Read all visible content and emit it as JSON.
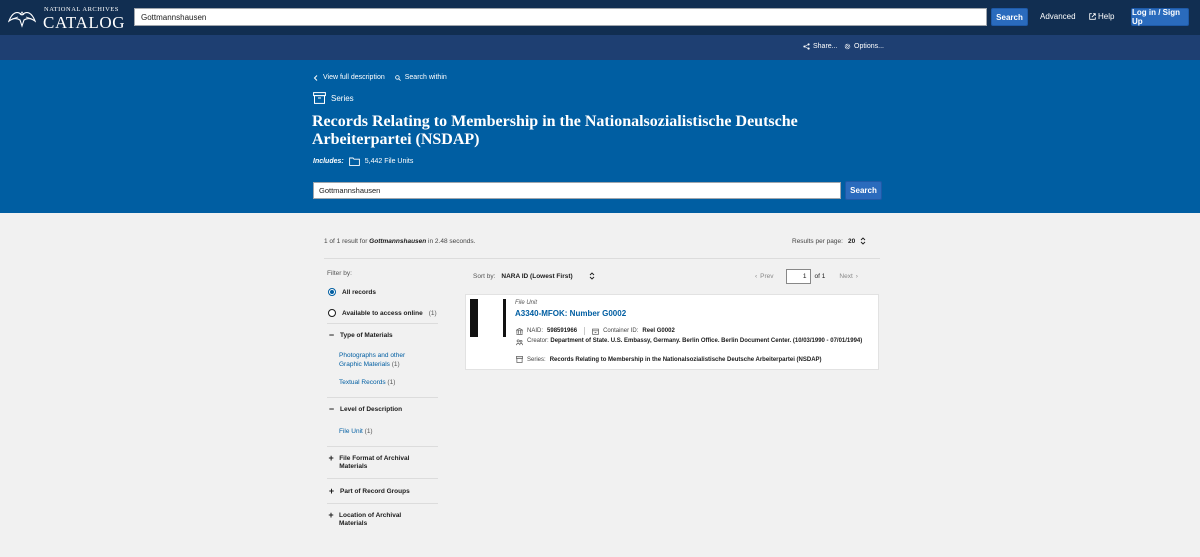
{
  "header": {
    "logo_top": "NATIONAL ARCHIVES",
    "logo_main": "CATALOG",
    "search_value": "Gottmannshausen",
    "search_label": "Search",
    "advanced_label": "Advanced",
    "help_label": "Help",
    "login_label": "Log in / Sign Up"
  },
  "subbar": {
    "share_label": "Share...",
    "options_label": "Options..."
  },
  "hero": {
    "back_label": "View full description",
    "search_within_label": "Search within",
    "level_label": "Series",
    "title": "Records Relating to Membership in the Nationalsozialistische Deutsche Arbeiterpartei (NSDAP)",
    "includes_label": "Includes:",
    "includes_value": "5,442 File Units",
    "search_value": "Gottmannshausen",
    "search_label": "Search"
  },
  "results": {
    "count_prefix": "1 of 1 result for",
    "query": "Gottmannshausen",
    "count_suffix": "in 2.48 seconds.",
    "per_page_label": "Results per page:",
    "per_page_value": "20"
  },
  "filters": {
    "title": "Filter by:",
    "all_records": "All records",
    "online_label": "Available to access online",
    "online_count": "(1)",
    "type_heading": "Type of Materials",
    "type_items": [
      {
        "label": "Photographs and other Graphic Materials",
        "count": "(1)"
      },
      {
        "label": "Textual Records",
        "count": "(1)"
      }
    ],
    "level_heading": "Level of Description",
    "level_items": [
      {
        "label": "File Unit",
        "count": "(1)"
      }
    ],
    "format_heading": "File Format of Archival Materials",
    "group_heading": "Part of Record Groups",
    "location_heading": "Location of Archival Materials"
  },
  "sort": {
    "label": "Sort by:",
    "value": "NARA ID (Lowest First)"
  },
  "pager": {
    "prev_label": "Prev",
    "page_value": "1",
    "of_label": "of 1",
    "next_label": "Next"
  },
  "result_card": {
    "kind": "File Unit",
    "title": "A3340-MFOK: Number G0002",
    "naid_label": "NAID:",
    "naid_value": "598591966",
    "container_label": "Container ID:",
    "container_value": "Reel G0002",
    "creator_label": "Creator:",
    "creator_value": "Department of State. U.S. Embassy, Germany. Berlin Office. Berlin Document Center. (10/03/1990 - 07/01/1994)",
    "series_label": "Series:",
    "series_value": "Records Relating to Membership in the Nationalsozialistische Deutsche Arbeiterpartei (NSDAP)"
  }
}
